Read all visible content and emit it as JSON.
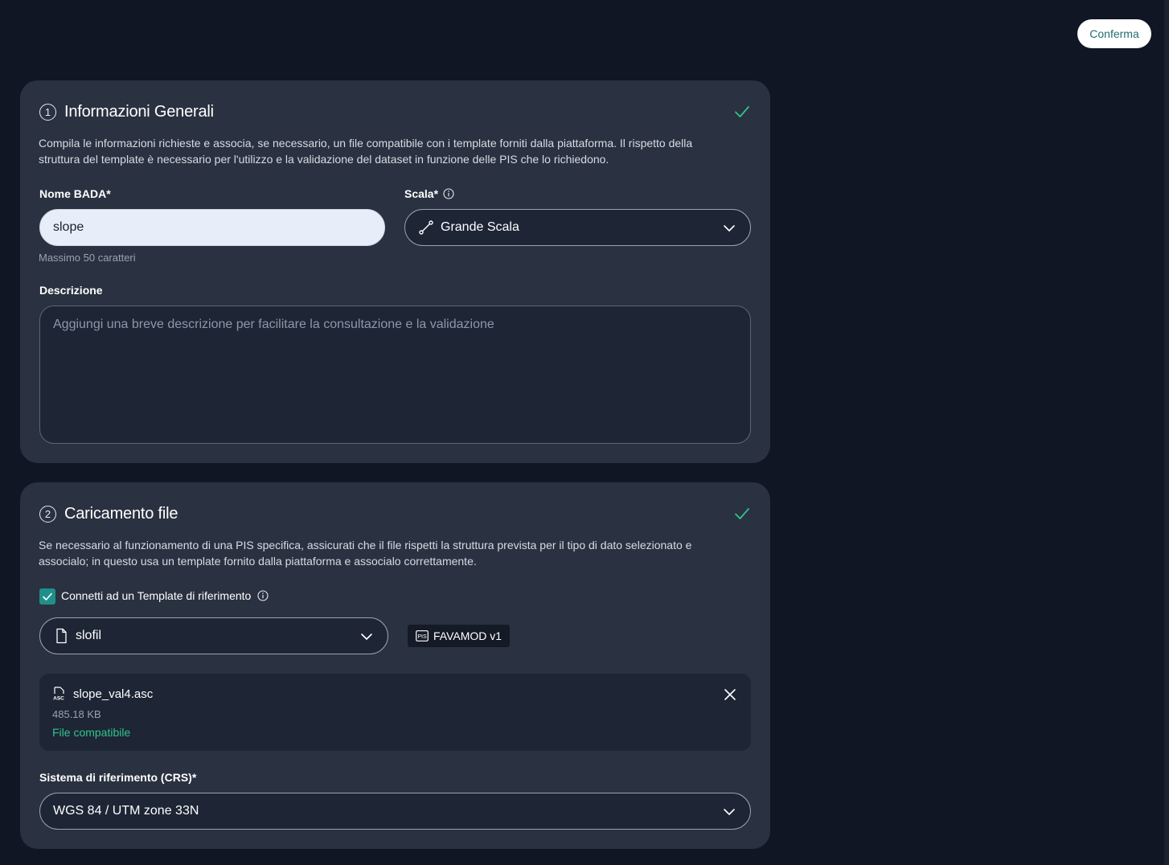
{
  "header": {
    "confirm_label": "Conferma"
  },
  "section1": {
    "step": "1",
    "title": "Informazioni Generali",
    "description": "Compila le informazioni richieste e associa, se necessario, un file compatibile con i template forniti dalla piattaforma. Il rispetto della struttura del template è necessario per l'utilizzo e la validazione del dataset in funzione delle PIS che lo richiedono.",
    "name_label": "Nome BADA*",
    "name_value": "slope",
    "name_hint": "Massimo 50 caratteri",
    "scale_label": "Scala*",
    "scale_value": "Grande Scala",
    "description_label": "Descrizione",
    "description_placeholder": "Aggiungi una breve descrizione per facilitare la consultazione e la validazione"
  },
  "section2": {
    "step": "2",
    "title": "Caricamento file",
    "description": "Se necessario al funzionamento di una PIS specifica, assicurati che il file rispetti la struttura prevista per il tipo di dato selezionato e associalo; in questo usa un template fornito dalla piattaforma e associalo correttamente.",
    "template_checkbox_label": "Connetti ad un Template di riferimento",
    "template_checked": true,
    "template_value": "slofil",
    "pis_badge": "FAVAMOD v1",
    "file": {
      "name": "slope_val4.asc",
      "size": "485.18 KB",
      "status": "File compatibile"
    },
    "crs_label": "Sistema di riferimento (CRS)*",
    "crs_value": "WGS 84 / UTM zone 33N"
  },
  "colors": {
    "background": "#101623",
    "card": "#2a3140",
    "accent": "#1f8f8a",
    "success": "#2fc48a"
  }
}
